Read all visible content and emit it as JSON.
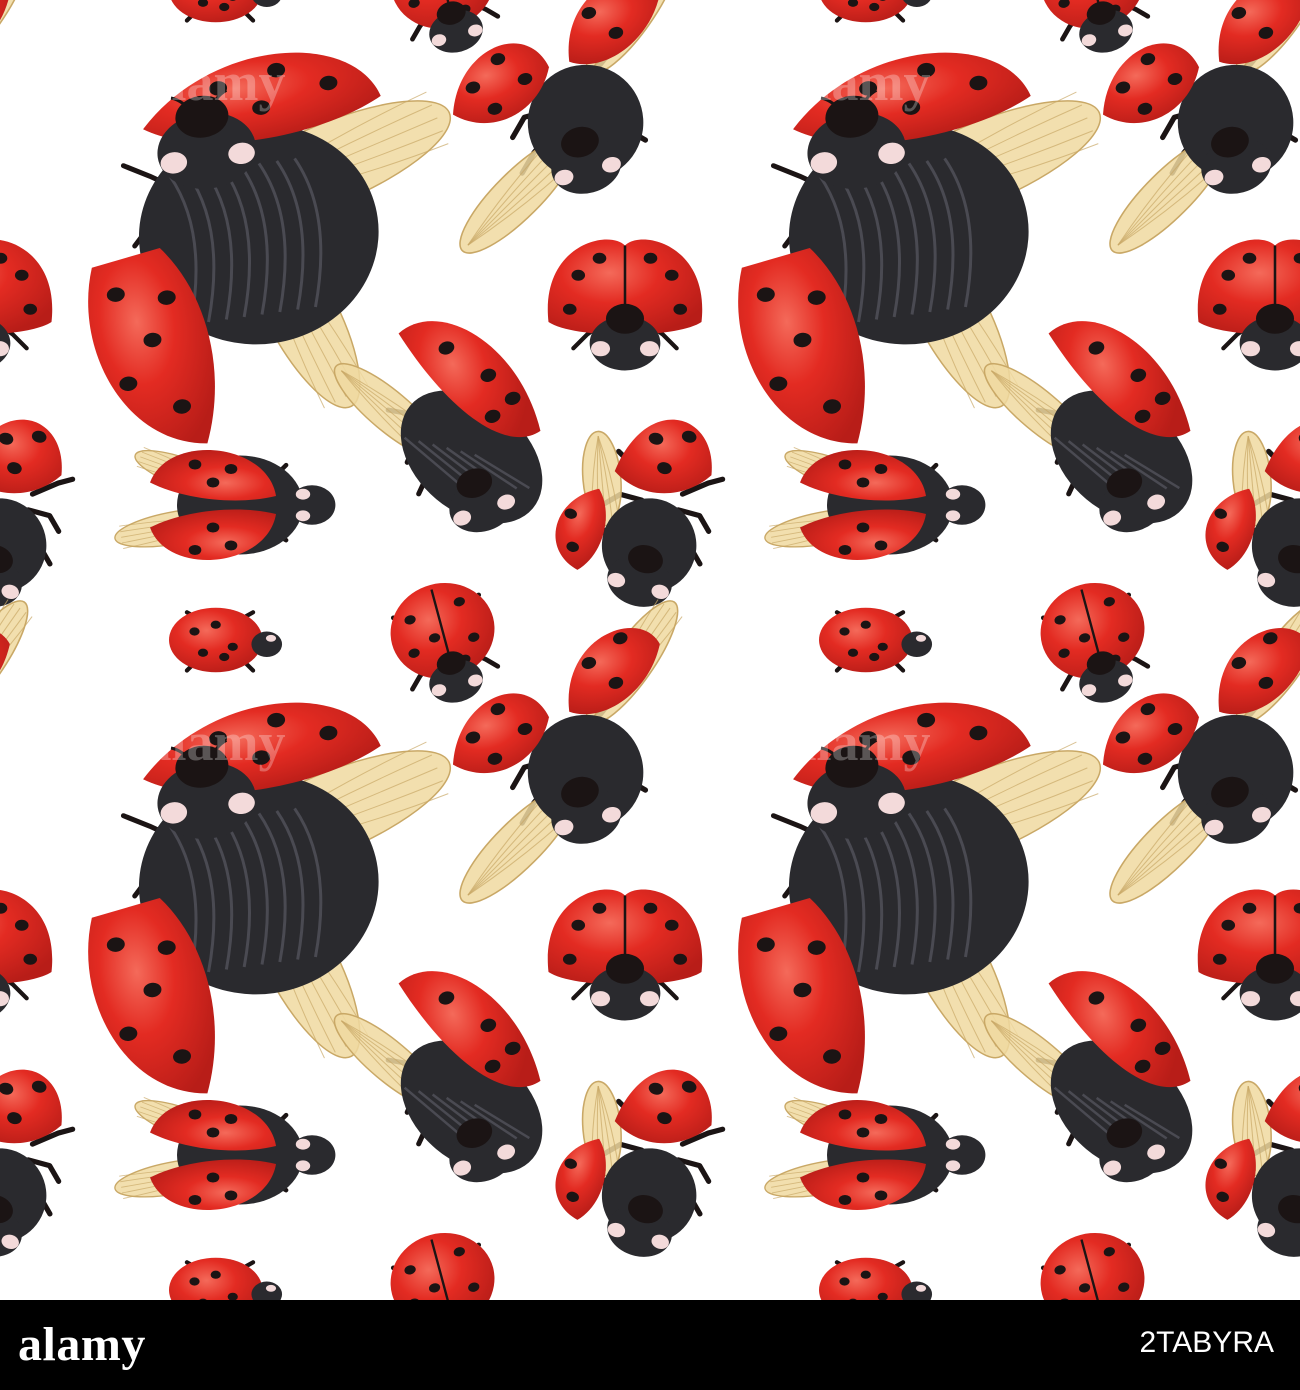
{
  "image": {
    "description_type": "watercolor seamless ladybug pattern",
    "background_color": "#ffffff",
    "colors": {
      "shell": "#e32b22",
      "shell_shadow": "#b81d18",
      "shell_highlight": "#f46a5a",
      "spot": "#1b1414",
      "body": "#2a2a2e",
      "body_stripe": "#4a4a52",
      "wing": "#f0d9a0",
      "wing_vein": "#c9a866",
      "head_mark": "#f3dada"
    },
    "tile_ladybugs": [
      {
        "pose": "flying-large"
      },
      {
        "pose": "flying-wings-up"
      },
      {
        "pose": "front-view"
      },
      {
        "pose": "side-wings-open"
      },
      {
        "pose": "side-walking"
      },
      {
        "pose": "flying-front"
      },
      {
        "pose": "small-walking"
      },
      {
        "pose": "small-top"
      }
    ]
  },
  "watermark": {
    "text": "alamy"
  },
  "footer": {
    "logo_text": "alamy",
    "image_id": "2TABYRA"
  }
}
